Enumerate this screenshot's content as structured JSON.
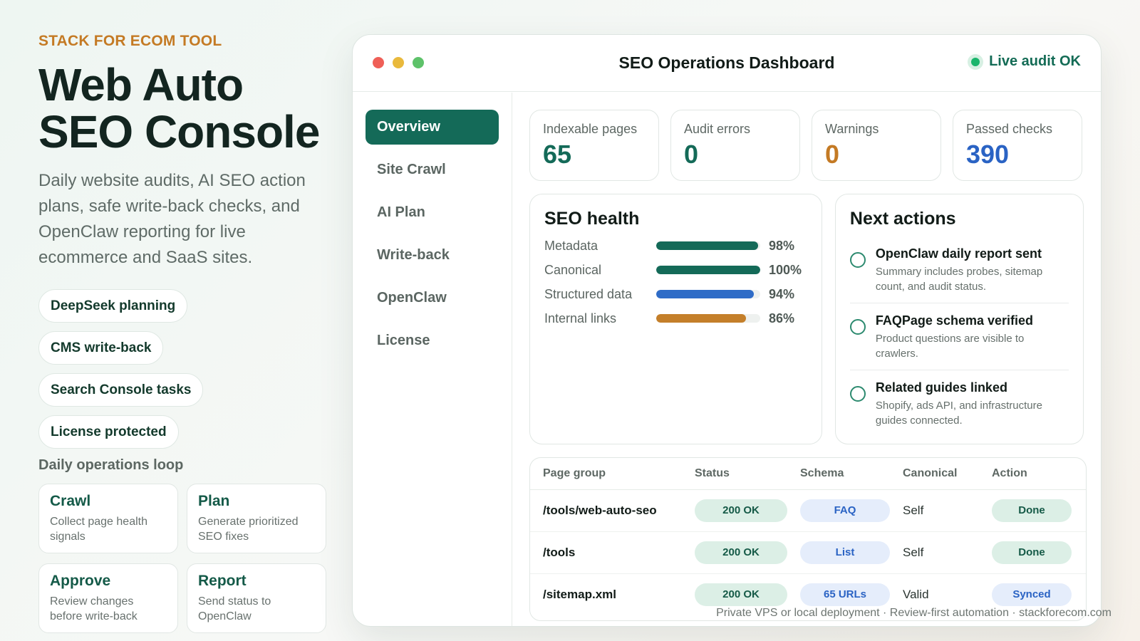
{
  "hero": {
    "eyebrow": "STACK FOR ECOM TOOL",
    "title_line1": "Web Auto",
    "title_line2": "SEO Console",
    "description": "Daily website audits, AI SEO action plans, safe write-back checks, and OpenClaw reporting for live ecommerce and SaaS sites.",
    "chips": [
      "DeepSeek planning",
      "CMS write-back",
      "Search Console tasks",
      "License protected"
    ],
    "loop_title": "Daily operations loop",
    "loop": [
      {
        "title": "Crawl",
        "desc": "Collect page health signals"
      },
      {
        "title": "Plan",
        "desc": "Generate prioritized SEO fixes"
      },
      {
        "title": "Approve",
        "desc": "Review changes before write-back"
      },
      {
        "title": "Report",
        "desc": "Send status to OpenClaw"
      }
    ]
  },
  "window": {
    "title": "SEO Operations Dashboard",
    "status": "Live audit OK",
    "status_color": "#19b56b"
  },
  "sidebar": {
    "items": [
      {
        "label": "Overview",
        "active": true
      },
      {
        "label": "Site Crawl",
        "active": false
      },
      {
        "label": "AI Plan",
        "active": false
      },
      {
        "label": "Write-back",
        "active": false
      },
      {
        "label": "OpenClaw",
        "active": false
      },
      {
        "label": "License",
        "active": false
      }
    ]
  },
  "stats": [
    {
      "label": "Indexable pages",
      "value": "65",
      "color": "#146a58"
    },
    {
      "label": "Audit errors",
      "value": "0",
      "color": "#146a58"
    },
    {
      "label": "Warnings",
      "value": "0",
      "color": "#c47a24"
    },
    {
      "label": "Passed checks",
      "value": "390",
      "color": "#2a63c4"
    }
  ],
  "health": {
    "title": "SEO health",
    "rows": [
      {
        "label": "Metadata",
        "value": 98,
        "pct": "98%",
        "color": "#146a58"
      },
      {
        "label": "Canonical",
        "value": 100,
        "pct": "100%",
        "color": "#146a58"
      },
      {
        "label": "Structured data",
        "value": 94,
        "pct": "94%",
        "color": "#2f6cc7"
      },
      {
        "label": "Internal links",
        "value": 86,
        "pct": "86%",
        "color": "#c47f2a"
      }
    ]
  },
  "actions": {
    "title": "Next actions",
    "items": [
      {
        "title": "OpenClaw daily report sent",
        "desc": "Summary includes probes, sitemap count, and audit status."
      },
      {
        "title": "FAQPage schema verified",
        "desc": "Product questions are visible to crawlers."
      },
      {
        "title": "Related guides linked",
        "desc": "Shopify, ads API, and infrastructure guides connected."
      }
    ]
  },
  "table": {
    "headers": [
      "Page group",
      "Status",
      "Schema",
      "Canonical",
      "Action"
    ],
    "rows": [
      {
        "page": "/tools/web-auto-seo",
        "status": "200 OK",
        "schema": "FAQ",
        "canonical": "Self",
        "action": "Done",
        "action_type": "done"
      },
      {
        "page": "/tools",
        "status": "200 OK",
        "schema": "List",
        "canonical": "Self",
        "action": "Done",
        "action_type": "done"
      },
      {
        "page": "/sitemap.xml",
        "status": "200 OK",
        "schema": "65 URLs",
        "canonical": "Valid",
        "action": "Synced",
        "action_type": "synced"
      }
    ]
  },
  "footer": "Private VPS or local deployment · Review-first automation · stackforecom.com"
}
